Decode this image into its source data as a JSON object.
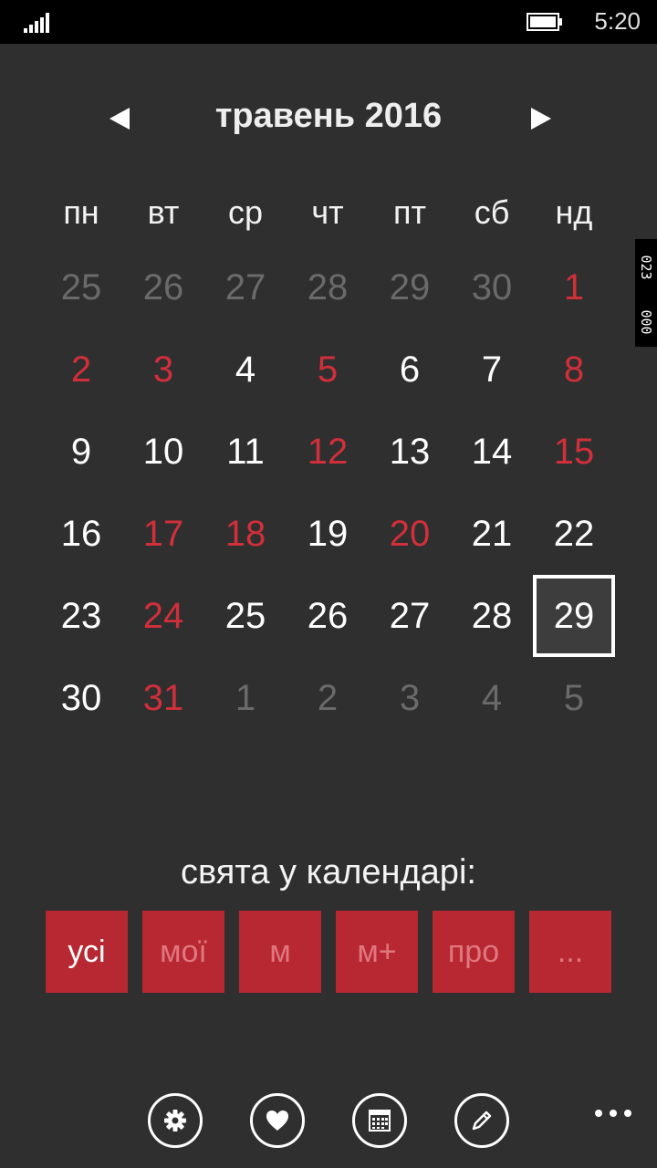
{
  "status_bar": {
    "time": "5:20"
  },
  "calendar": {
    "title": "травень 2016",
    "weekdays": [
      "пн",
      "вт",
      "ср",
      "чт",
      "пт",
      "сб",
      "нд"
    ],
    "weeks": [
      [
        {
          "d": "25",
          "t": "other"
        },
        {
          "d": "26",
          "t": "other"
        },
        {
          "d": "27",
          "t": "other"
        },
        {
          "d": "28",
          "t": "other"
        },
        {
          "d": "29",
          "t": "other"
        },
        {
          "d": "30",
          "t": "other"
        },
        {
          "d": "1",
          "t": "holiday"
        }
      ],
      [
        {
          "d": "2",
          "t": "holiday"
        },
        {
          "d": "3",
          "t": "holiday"
        },
        {
          "d": "4",
          "t": "normal"
        },
        {
          "d": "5",
          "t": "holiday"
        },
        {
          "d": "6",
          "t": "normal"
        },
        {
          "d": "7",
          "t": "normal"
        },
        {
          "d": "8",
          "t": "holiday"
        }
      ],
      [
        {
          "d": "9",
          "t": "normal"
        },
        {
          "d": "10",
          "t": "normal"
        },
        {
          "d": "11",
          "t": "normal"
        },
        {
          "d": "12",
          "t": "holiday"
        },
        {
          "d": "13",
          "t": "normal"
        },
        {
          "d": "14",
          "t": "normal"
        },
        {
          "d": "15",
          "t": "holiday"
        }
      ],
      [
        {
          "d": "16",
          "t": "normal"
        },
        {
          "d": "17",
          "t": "holiday"
        },
        {
          "d": "18",
          "t": "holiday"
        },
        {
          "d": "19",
          "t": "normal"
        },
        {
          "d": "20",
          "t": "holiday"
        },
        {
          "d": "21",
          "t": "normal"
        },
        {
          "d": "22",
          "t": "normal"
        }
      ],
      [
        {
          "d": "23",
          "t": "normal"
        },
        {
          "d": "24",
          "t": "holiday"
        },
        {
          "d": "25",
          "t": "normal"
        },
        {
          "d": "26",
          "t": "normal"
        },
        {
          "d": "27",
          "t": "normal"
        },
        {
          "d": "28",
          "t": "normal"
        },
        {
          "d": "29",
          "t": "today"
        }
      ],
      [
        {
          "d": "30",
          "t": "normal"
        },
        {
          "d": "31",
          "t": "holiday"
        },
        {
          "d": "1",
          "t": "other"
        },
        {
          "d": "2",
          "t": "other"
        },
        {
          "d": "3",
          "t": "other"
        },
        {
          "d": "4",
          "t": "other"
        },
        {
          "d": "5",
          "t": "other"
        }
      ]
    ]
  },
  "side_counter": {
    "top": "023",
    "bottom": "000"
  },
  "holidays": {
    "label": "свята у календарі:",
    "filters": [
      "усі",
      "мої",
      "м",
      "м+",
      "про",
      "..."
    ],
    "active_filter": "усі"
  },
  "appbar": {
    "icons": [
      "settings-icon",
      "heart-icon",
      "calendar-icon",
      "edit-icon",
      "more-icon"
    ]
  },
  "colors": {
    "background": "#2f2f2f",
    "holiday_text": "#d12f3a",
    "filter_button": "#b72832",
    "other_month_text": "#6a6a6a"
  }
}
